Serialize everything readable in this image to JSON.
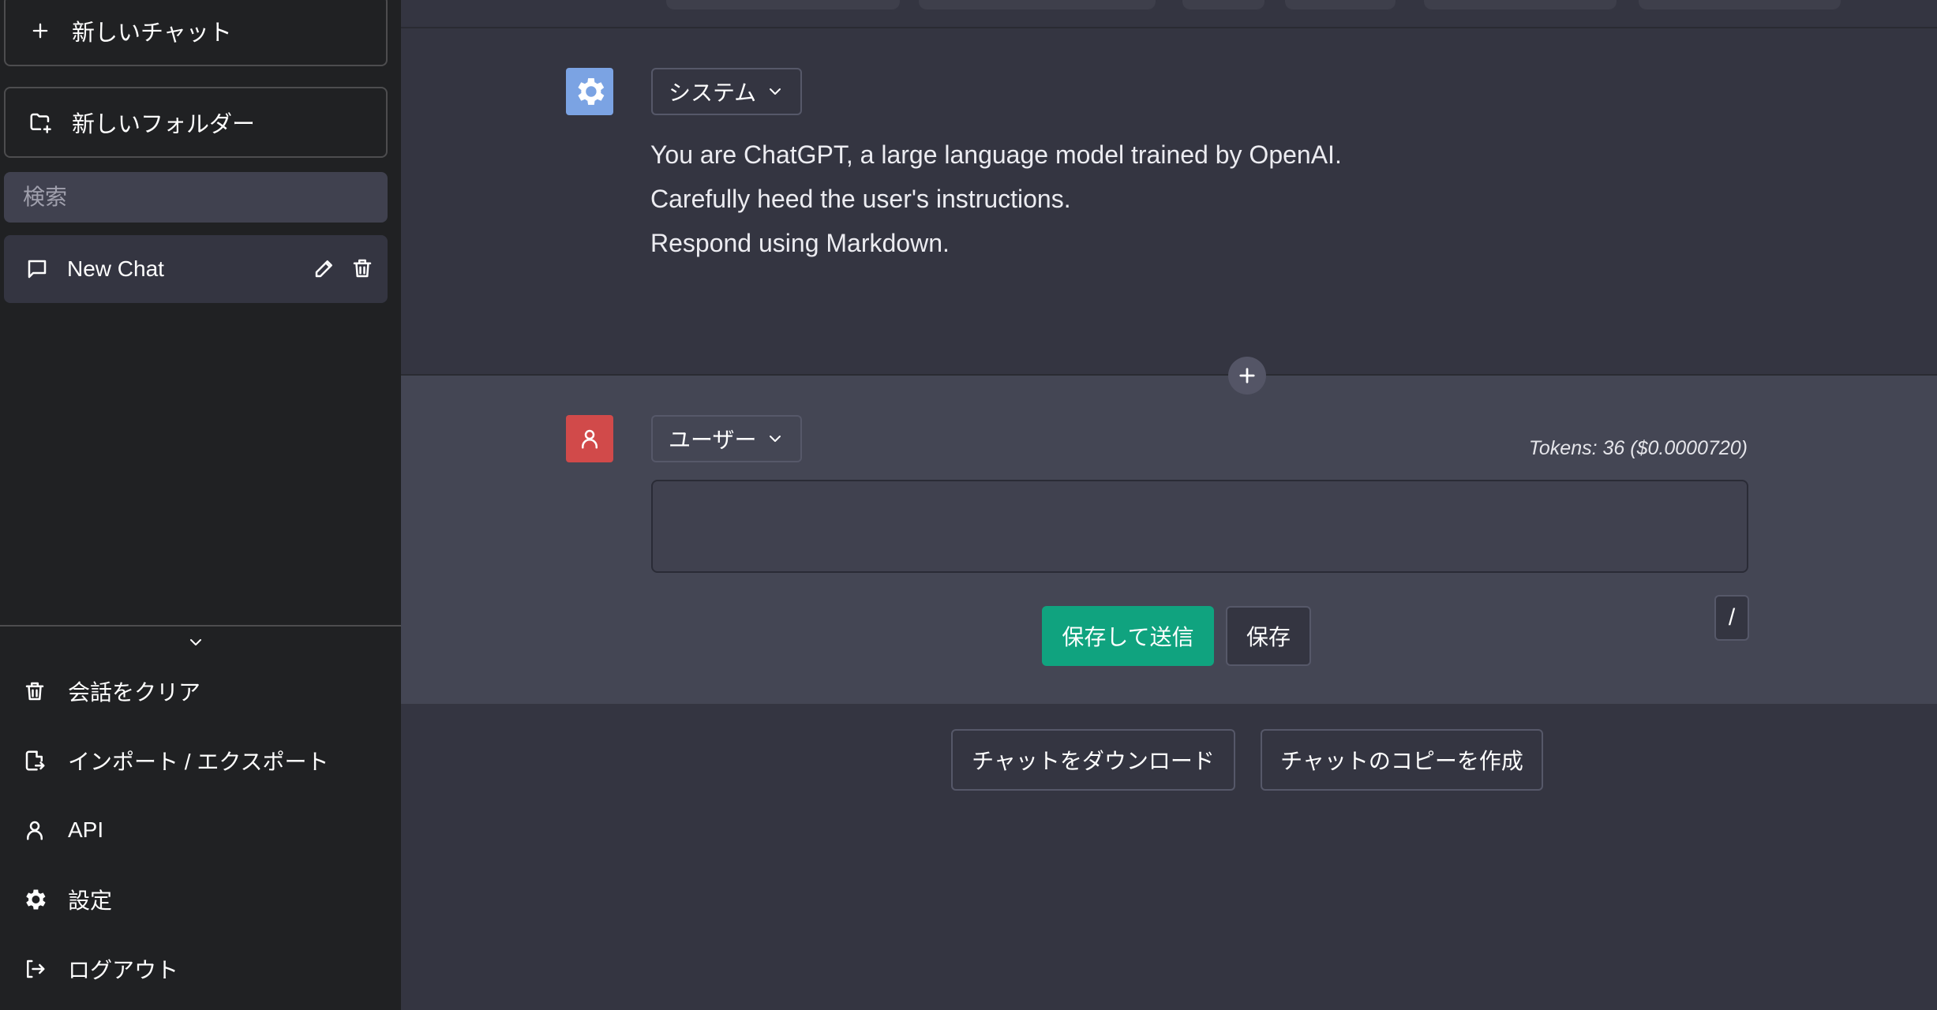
{
  "sidebar": {
    "new_chat_label": "新しいチャット",
    "new_folder_label": "新しいフォルダー",
    "search_placeholder": "検索",
    "chats": [
      {
        "title": "New Chat"
      }
    ],
    "menu": {
      "clear": "会話をクリア",
      "import_export": "インポート / エクスポート",
      "api": "API",
      "settings": "設定",
      "logout": "ログアウト"
    }
  },
  "main": {
    "system_message": {
      "role": "システム",
      "lines": [
        "You are ChatGPT, a large language model trained by OpenAI.",
        "Carefully heed the user's instructions.",
        "Respond using Markdown."
      ]
    },
    "user_message": {
      "role": "ユーザー",
      "tokens": "Tokens: 36 ($0.0000720)",
      "save_and_submit": "保存して送信",
      "save": "保存",
      "slash": "/"
    },
    "footer": {
      "download": "チャットをダウンロード",
      "clone": "チャットのコピーを作成"
    }
  },
  "colors": {
    "sidebar_bg": "#202123",
    "main_bg": "#343541",
    "user_bg": "#444654",
    "accent_green": "#10a37f",
    "system_avatar": "#7ba3e3",
    "user_avatar": "#d14a4a"
  },
  "icons": {
    "new_chat": "plus-icon",
    "new_folder": "folder-plus-icon",
    "chat": "message-icon",
    "edit": "pencil-icon",
    "delete": "trash-icon",
    "collapse": "chevron-down-icon",
    "clear": "trash-icon",
    "import_export": "file-export-icon",
    "api": "person-icon",
    "settings": "gear-icon",
    "logout": "logout-icon"
  }
}
